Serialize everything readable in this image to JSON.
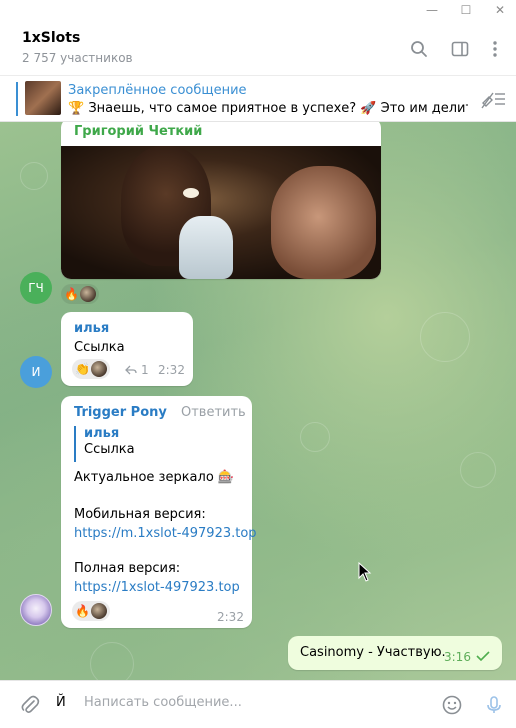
{
  "window": {
    "min_glyph": "—",
    "max_glyph": "☐",
    "close_glyph": "✕"
  },
  "header": {
    "title": "1xSlots",
    "subtitle": "2 757 участников"
  },
  "pinned": {
    "title": "Закреплённое сообщение",
    "text": "🏆 Знаешь, что самое приятное в успехе? 🚀 Это им делить…"
  },
  "messages": [
    {
      "author": "Григорий Четкий",
      "author_color": "#3fa84a",
      "avatar_initials": "ГЧ",
      "avatar_color": "#4ab05a",
      "reaction_emoji": "🔥"
    },
    {
      "author": "илья",
      "author_color": "#2a7cc4",
      "avatar_initials": "И",
      "avatar_color": "#4a9fdb",
      "text": "Ссылка",
      "reaction_emoji": "👏",
      "reply_count": "1",
      "time": "2:32"
    },
    {
      "author": "Trigger Pony",
      "author_color": "#2a7cc4",
      "reply_action": "Ответить",
      "quote_author": "илья",
      "quote_text": "Ссылка",
      "line1": "Актуальное зеркало 🎰",
      "line2": "Мобильная версия:",
      "link1": "https://m.1xslot-497923.top",
      "line3": "Полная версия:",
      "link2": "https://1xslot-497923.top",
      "reaction_emoji": "🔥",
      "time": "2:32"
    },
    {
      "text": "Casinomy - Участвую.",
      "time": "3:16",
      "outgoing": true
    }
  ],
  "composer": {
    "typed": "Й",
    "placeholder": "Написать сообщение..."
  },
  "colors": {
    "accent": "#3a8fd3",
    "outgoing_bubble": "#effdde",
    "read_check": "#4fae4e"
  }
}
